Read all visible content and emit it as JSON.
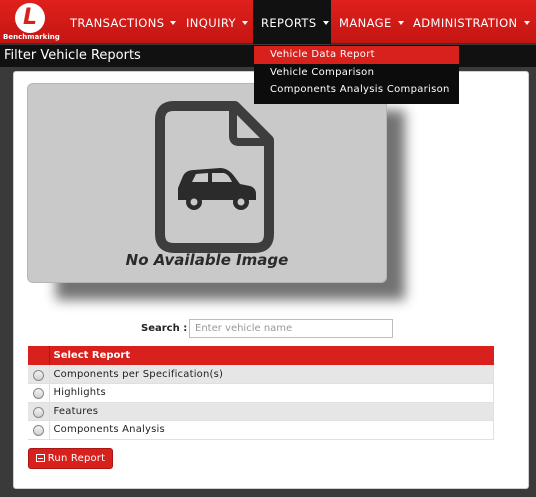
{
  "app": {
    "logo_letter": "L",
    "logo_text": "Benchmarking"
  },
  "nav": {
    "items": [
      {
        "label": "TRANSACTIONS"
      },
      {
        "label": "INQUIRY"
      },
      {
        "label": "REPORTS"
      },
      {
        "label": "MANAGE"
      },
      {
        "label": "ADMINISTRATION"
      }
    ],
    "active": "REPORTS",
    "reports_menu": [
      {
        "label": "Vehicle Data Report",
        "highlighted": true
      },
      {
        "label": "Vehicle Comparison"
      },
      {
        "label": "Components Analysis Comparison"
      }
    ]
  },
  "page": {
    "title": "Filter Vehicle Reports"
  },
  "vehicle_image": {
    "caption": "No Available Image",
    "icon": "car-document-icon"
  },
  "search": {
    "label": "Search :",
    "placeholder": "Enter vehicle name",
    "value": ""
  },
  "report_table": {
    "header": "Select Report",
    "rows": [
      {
        "label": "Components per Specification(s)",
        "selected": false
      },
      {
        "label": "Highlights",
        "selected": false
      },
      {
        "label": "Features",
        "selected": false
      },
      {
        "label": "Components Analysis",
        "selected": false
      }
    ]
  },
  "actions": {
    "run_label": "Run Report"
  },
  "colors": {
    "brand_red": "#d8201c",
    "dark": "#111111",
    "panel_bg": "#ffffff"
  }
}
